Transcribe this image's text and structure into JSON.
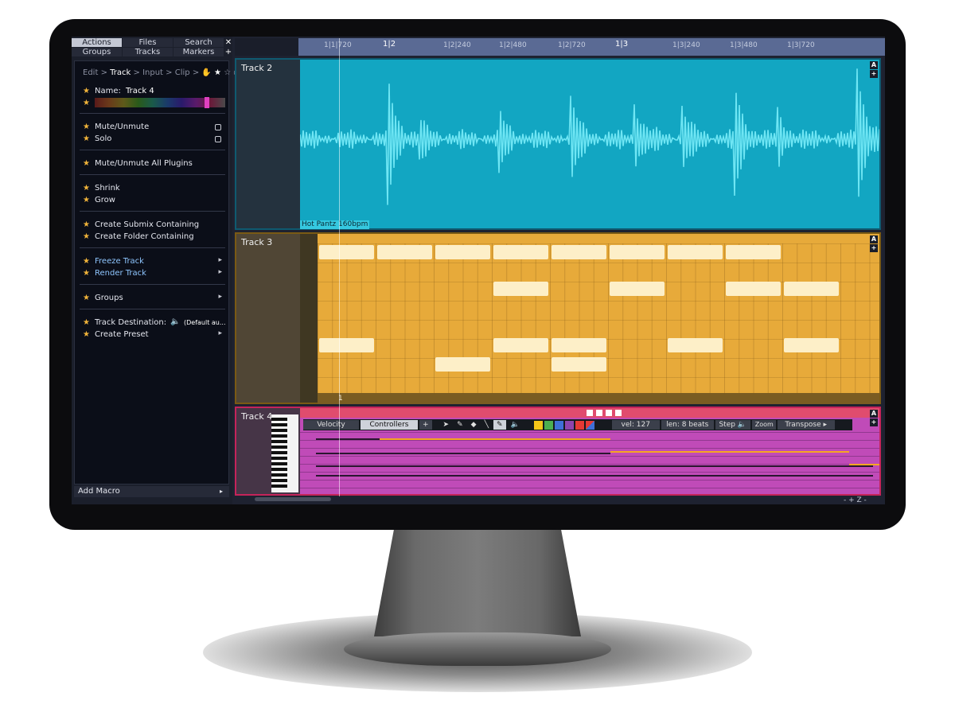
{
  "browser_tabs": {
    "row1": [
      "Actions",
      "Files",
      "Search"
    ],
    "row2": [
      "Groups",
      "Tracks",
      "Markers"
    ],
    "close": "✕",
    "add": "+"
  },
  "breadcrumb": {
    "edit": "Edit",
    "track": "Track",
    "input": "Input",
    "clip": "Clip",
    "sep": ">"
  },
  "actions": {
    "name_label": "Name:",
    "name_value": "Track 4",
    "mute": "Mute/Unmute",
    "solo": "Solo",
    "mute_plugins": "Mute/Unmute All Plugins",
    "shrink": "Shrink",
    "grow": "Grow",
    "submix": "Create Submix Containing",
    "folder": "Create Folder Containing",
    "freeze": "Freeze Track",
    "render": "Render Track",
    "groups": "Groups",
    "destination_label": "Track Destination:",
    "destination_value": "(Default au...",
    "preset": "Create Preset",
    "star": "★",
    "arrow": "▸"
  },
  "add_macro": "Add Macro",
  "ruler": {
    "ticks": [
      "1|1|720",
      "1|2",
      "1|2|240",
      "1|2|480",
      "1|2|720",
      "1|3",
      "1|3|240",
      "1|3|480",
      "1|3|720"
    ]
  },
  "tracks": {
    "t2": {
      "name": "Track 2",
      "clip": "Hot Pantz 160bpm"
    },
    "t3": {
      "name": "Track 3",
      "bar": "1"
    },
    "t4": {
      "name": "Track 4"
    }
  },
  "track_buttons": {
    "auto": "A",
    "plus": "+"
  },
  "midi_toolbar": {
    "velocity": "Velocity",
    "controllers": "Controllers",
    "plus": "+",
    "vel": "vel: 127",
    "len": "len: 8 beats",
    "step": "Step",
    "zoom": "Zoom",
    "transpose": "Transpose",
    "colors": [
      "#f5c518",
      "#4caf50",
      "#3f6fd8",
      "#8e44ad",
      "#e53935"
    ]
  },
  "status": {
    "right": "- + Z -"
  },
  "colors": {
    "audio_clip": "#12a6c2",
    "midi_clip_3": "#e7aa3a",
    "midi_clip_4": "#c04bb8",
    "accent_red": "#e0313c",
    "star": "#f1b43a"
  }
}
